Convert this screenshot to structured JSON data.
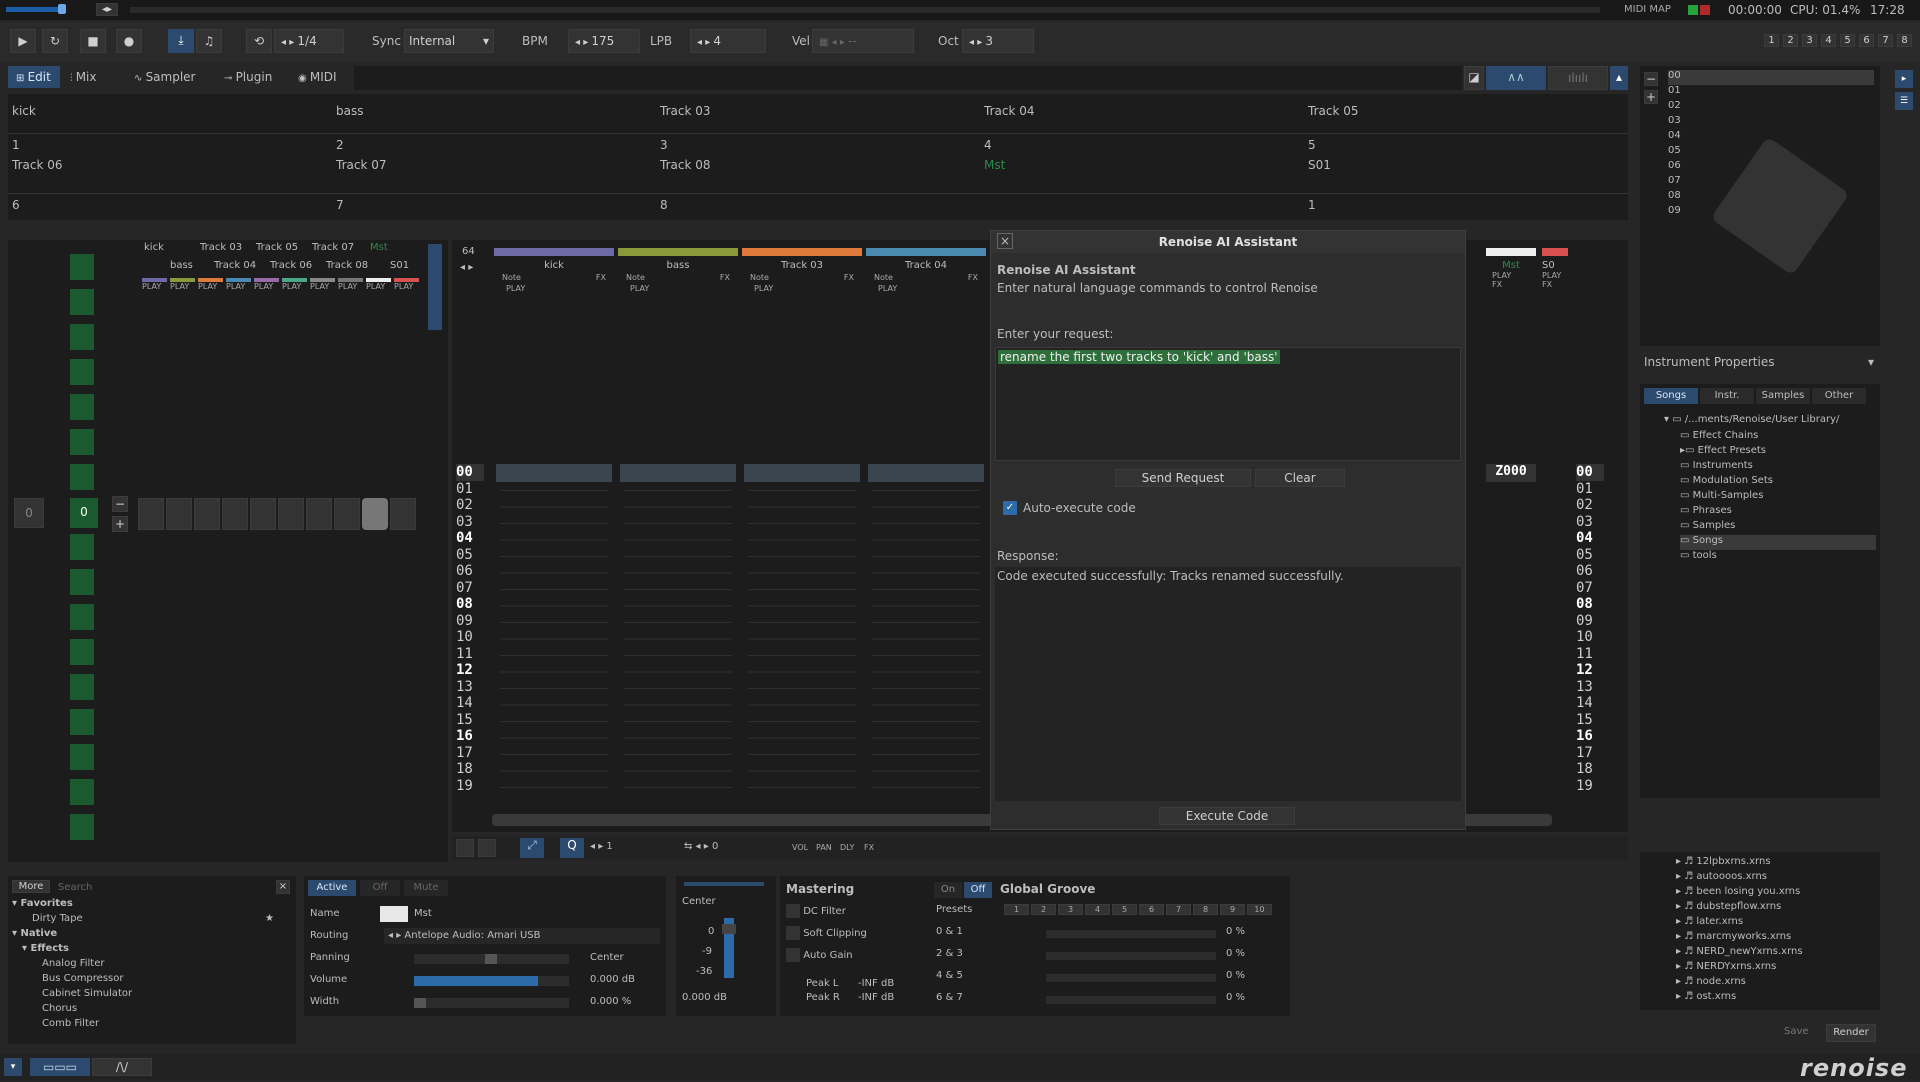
{
  "topbar": {
    "time": "00:00:00",
    "cpu": "CPU: 01.4%",
    "clock": "17:28",
    "midimap": "MIDI MAP"
  },
  "transport": {
    "step": "1/4",
    "sync_label": "Sync",
    "sync_value": "Internal",
    "bpm_label": "BPM",
    "bpm": "175",
    "lpb_label": "LPB",
    "lpb": "4",
    "vel_label": "Vel",
    "vel_value": "--",
    "oct_label": "Oct",
    "oct": "3",
    "pages": [
      "1",
      "2",
      "3",
      "4",
      "5",
      "6",
      "7",
      "8"
    ]
  },
  "tabs": [
    "Edit",
    "Mix",
    "Sampler",
    "Plugin",
    "MIDI"
  ],
  "track_grid": [
    [
      "kick",
      "bass",
      "Track 03",
      "Track 04",
      "Track 05"
    ],
    [
      "1",
      "2",
      "3",
      "4",
      "5"
    ],
    [
      "Track 06",
      "Track 07",
      "Track 08",
      "Mst",
      "S01"
    ],
    [
      "6",
      "7",
      "8",
      "",
      "1"
    ]
  ],
  "pattern_matrix": {
    "names_top": [
      "kick",
      "Track 03",
      "Track 05",
      "Track 07",
      "Mst"
    ],
    "names_bottom": [
      "bass",
      "Track 04",
      "Track 06",
      "Track 08",
      "S01"
    ],
    "play": "PLAY",
    "seq_left": "0",
    "seq_right": "0"
  },
  "pattern_editor": {
    "lines": "64",
    "tracks": [
      {
        "name": "kick",
        "color": "#6e6aa8"
      },
      {
        "name": "bass",
        "color": "#8a9a3a"
      },
      {
        "name": "Track 03",
        "color": "#e07a3c"
      },
      {
        "name": "Track 04",
        "color": "#4a8ab0"
      }
    ],
    "note": "Note",
    "fx": "FX",
    "play": "PLAY",
    "rows": [
      "00",
      "01",
      "02",
      "03",
      "04",
      "05",
      "06",
      "07",
      "08",
      "09",
      "10",
      "11",
      "12",
      "13",
      "14",
      "15",
      "16",
      "17",
      "18",
      "19"
    ],
    "mst": "Mst",
    "s01": "S0",
    "z_value": "Z000"
  },
  "editor_toolbar": {
    "q_value": "1",
    "step_value": "0",
    "vol": "VOL",
    "pan": "PAN",
    "dly": "DLY",
    "fx": "FX"
  },
  "dialog": {
    "title": "Renoise AI Assistant",
    "heading": "Renoise AI Assistant",
    "subtitle": "Enter natural language commands to control Renoise",
    "request_label": "Enter your request:",
    "request_text": "rename the first two tracks to 'kick' and 'bass'",
    "send": "Send Request",
    "clear": "Clear",
    "auto_exec": "Auto-execute code",
    "response_label": "Response:",
    "response_text": "Code executed successfully: Tracks renamed successfully.",
    "execute": "Execute Code"
  },
  "right_panel": {
    "instr_list": [
      "00",
      "01",
      "02",
      "03",
      "04",
      "05",
      "06",
      "07",
      "08",
      "09"
    ],
    "instr_props": "Instrument Properties",
    "browser_tabs": [
      "Songs",
      "Instr.",
      "Samples",
      "Other"
    ],
    "path": "/...ments/Renoise/User Library/",
    "folders": [
      "Effect Chains",
      "Effect Presets",
      "Instruments",
      "Modulation Sets",
      "Multi-Samples",
      "Phrases",
      "Samples",
      "Songs",
      "tools"
    ],
    "files": [
      "12lpbxrns.xrns",
      "autoooos.xrns",
      "been losing you.xrns",
      "dubstepflow.xrns",
      "later.xrns",
      "marcmyworks.xrns",
      "NERD_newYxrns.xrns",
      "NERDYxrns.xrns",
      "node.xrns",
      "ost.xrns"
    ],
    "save": "Save",
    "render": "Render",
    "logo": "renoise"
  },
  "dsp_browser": {
    "more": "More",
    "search": "Search",
    "favorites": "Favorites",
    "fav_items": [
      "Dirty Tape"
    ],
    "native": "Native",
    "effects": "Effects",
    "effect_items": [
      "Analog Filter",
      "Bus Compressor",
      "Cabinet Simulator",
      "Chorus",
      "Comb Filter"
    ]
  },
  "track_props": {
    "active": "Active",
    "off": "Off",
    "mute": "Mute",
    "name_label": "Name",
    "name_value": "Mst",
    "routing_label": "Routing",
    "routing_value": "Antelope Audio: Amari USB",
    "panning_label": "Panning",
    "panning_value": "Center",
    "volume_label": "Volume",
    "volume_value": "0.000 dB",
    "width_label": "Width",
    "width_value": "0.000 %",
    "volume_level": 0.8,
    "width_level": 0.0
  },
  "fader": {
    "center": "Center",
    "scale": [
      "0",
      "-9",
      "-36"
    ],
    "db": "0.000 dB"
  },
  "mastering": {
    "title": "Mastering",
    "items": [
      "DC Filter",
      "Soft Clipping",
      "Auto Gain"
    ],
    "peak_l_label": "Peak L",
    "peak_l": "-INF dB",
    "peak_r_label": "Peak R",
    "peak_r": "-INF dB"
  },
  "groove": {
    "on": "On",
    "off": "Off",
    "title": "Global Groove",
    "presets_label": "Presets",
    "presets": [
      "0 & 1",
      "2 & 3",
      "4 & 5",
      "6 & 7"
    ],
    "nums": [
      "1",
      "2",
      "3",
      "4",
      "5",
      "6",
      "7",
      "8",
      "9",
      "10"
    ],
    "values": [
      "0 %",
      "0 %",
      "0 %",
      "0 %"
    ]
  }
}
